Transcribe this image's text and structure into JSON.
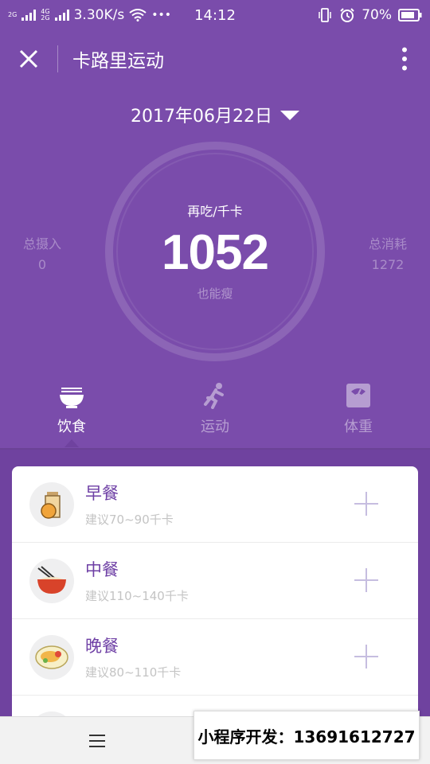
{
  "status_bar": {
    "network_1": "2G",
    "network_2": "4G",
    "network_3": "2G",
    "speed": "3.30K/s",
    "wifi_icon": "wifi-icon",
    "more": "•••",
    "time": "14:12",
    "battery": "70%"
  },
  "title_bar": {
    "title": "卡路里运动",
    "close_icon": "close-icon",
    "more_icon": "more-vertical-icon"
  },
  "date": "2017年06月22日",
  "summary": {
    "label": "再吃/千卡",
    "value": "1052",
    "sub": "也能瘦",
    "intake_label": "总摄入",
    "intake_value": "0",
    "burn_label": "总消耗",
    "burn_value": "1272"
  },
  "tabs": [
    {
      "label": "饮食",
      "icon": "bowl-icon",
      "active": true
    },
    {
      "label": "运动",
      "icon": "running-icon",
      "active": false
    },
    {
      "label": "体重",
      "icon": "scale-icon",
      "active": false
    }
  ],
  "meals": [
    {
      "name": "早餐",
      "hint": "建议70~90千卡",
      "icon": "breakfast-icon"
    },
    {
      "name": "中餐",
      "hint": "建议110~140千卡",
      "icon": "lunch-icon"
    },
    {
      "name": "晚餐",
      "hint": "建议80~110千卡",
      "icon": "dinner-icon"
    }
  ],
  "promo": "小程序开发：13691612727",
  "colors": {
    "primary": "#7a4cab",
    "secondary": "#6f429f",
    "meal_name": "#6e3fa5",
    "hint": "#c4c4c4"
  }
}
